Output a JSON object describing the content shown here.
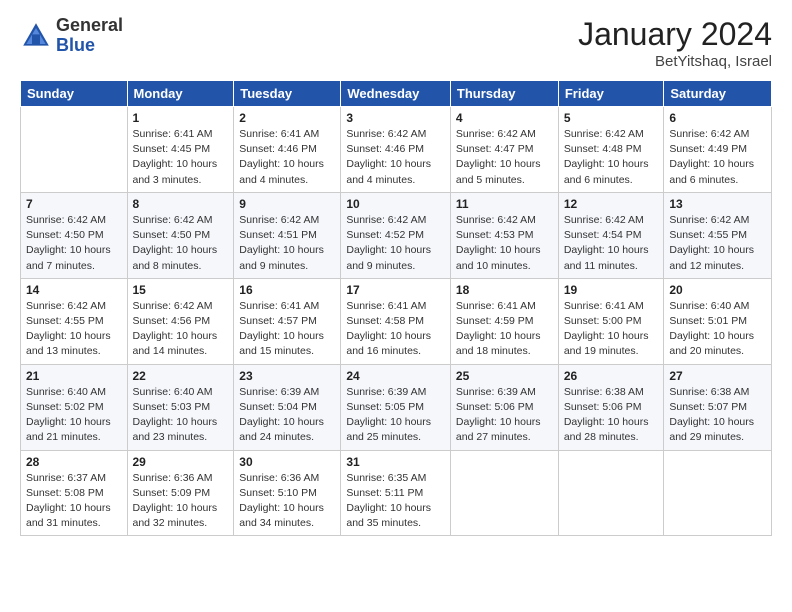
{
  "header": {
    "logo_general": "General",
    "logo_blue": "Blue",
    "title": "January 2024",
    "location": "BetYitshaq, Israel"
  },
  "days_of_week": [
    "Sunday",
    "Monday",
    "Tuesday",
    "Wednesday",
    "Thursday",
    "Friday",
    "Saturday"
  ],
  "weeks": [
    [
      {
        "day": "",
        "info": ""
      },
      {
        "day": "1",
        "info": "Sunrise: 6:41 AM\nSunset: 4:45 PM\nDaylight: 10 hours\nand 3 minutes."
      },
      {
        "day": "2",
        "info": "Sunrise: 6:41 AM\nSunset: 4:46 PM\nDaylight: 10 hours\nand 4 minutes."
      },
      {
        "day": "3",
        "info": "Sunrise: 6:42 AM\nSunset: 4:46 PM\nDaylight: 10 hours\nand 4 minutes."
      },
      {
        "day": "4",
        "info": "Sunrise: 6:42 AM\nSunset: 4:47 PM\nDaylight: 10 hours\nand 5 minutes."
      },
      {
        "day": "5",
        "info": "Sunrise: 6:42 AM\nSunset: 4:48 PM\nDaylight: 10 hours\nand 6 minutes."
      },
      {
        "day": "6",
        "info": "Sunrise: 6:42 AM\nSunset: 4:49 PM\nDaylight: 10 hours\nand 6 minutes."
      }
    ],
    [
      {
        "day": "7",
        "info": "Sunrise: 6:42 AM\nSunset: 4:50 PM\nDaylight: 10 hours\nand 7 minutes."
      },
      {
        "day": "8",
        "info": "Sunrise: 6:42 AM\nSunset: 4:50 PM\nDaylight: 10 hours\nand 8 minutes."
      },
      {
        "day": "9",
        "info": "Sunrise: 6:42 AM\nSunset: 4:51 PM\nDaylight: 10 hours\nand 9 minutes."
      },
      {
        "day": "10",
        "info": "Sunrise: 6:42 AM\nSunset: 4:52 PM\nDaylight: 10 hours\nand 9 minutes."
      },
      {
        "day": "11",
        "info": "Sunrise: 6:42 AM\nSunset: 4:53 PM\nDaylight: 10 hours\nand 10 minutes."
      },
      {
        "day": "12",
        "info": "Sunrise: 6:42 AM\nSunset: 4:54 PM\nDaylight: 10 hours\nand 11 minutes."
      },
      {
        "day": "13",
        "info": "Sunrise: 6:42 AM\nSunset: 4:55 PM\nDaylight: 10 hours\nand 12 minutes."
      }
    ],
    [
      {
        "day": "14",
        "info": "Sunrise: 6:42 AM\nSunset: 4:55 PM\nDaylight: 10 hours\nand 13 minutes."
      },
      {
        "day": "15",
        "info": "Sunrise: 6:42 AM\nSunset: 4:56 PM\nDaylight: 10 hours\nand 14 minutes."
      },
      {
        "day": "16",
        "info": "Sunrise: 6:41 AM\nSunset: 4:57 PM\nDaylight: 10 hours\nand 15 minutes."
      },
      {
        "day": "17",
        "info": "Sunrise: 6:41 AM\nSunset: 4:58 PM\nDaylight: 10 hours\nand 16 minutes."
      },
      {
        "day": "18",
        "info": "Sunrise: 6:41 AM\nSunset: 4:59 PM\nDaylight: 10 hours\nand 18 minutes."
      },
      {
        "day": "19",
        "info": "Sunrise: 6:41 AM\nSunset: 5:00 PM\nDaylight: 10 hours\nand 19 minutes."
      },
      {
        "day": "20",
        "info": "Sunrise: 6:40 AM\nSunset: 5:01 PM\nDaylight: 10 hours\nand 20 minutes."
      }
    ],
    [
      {
        "day": "21",
        "info": "Sunrise: 6:40 AM\nSunset: 5:02 PM\nDaylight: 10 hours\nand 21 minutes."
      },
      {
        "day": "22",
        "info": "Sunrise: 6:40 AM\nSunset: 5:03 PM\nDaylight: 10 hours\nand 23 minutes."
      },
      {
        "day": "23",
        "info": "Sunrise: 6:39 AM\nSunset: 5:04 PM\nDaylight: 10 hours\nand 24 minutes."
      },
      {
        "day": "24",
        "info": "Sunrise: 6:39 AM\nSunset: 5:05 PM\nDaylight: 10 hours\nand 25 minutes."
      },
      {
        "day": "25",
        "info": "Sunrise: 6:39 AM\nSunset: 5:06 PM\nDaylight: 10 hours\nand 27 minutes."
      },
      {
        "day": "26",
        "info": "Sunrise: 6:38 AM\nSunset: 5:06 PM\nDaylight: 10 hours\nand 28 minutes."
      },
      {
        "day": "27",
        "info": "Sunrise: 6:38 AM\nSunset: 5:07 PM\nDaylight: 10 hours\nand 29 minutes."
      }
    ],
    [
      {
        "day": "28",
        "info": "Sunrise: 6:37 AM\nSunset: 5:08 PM\nDaylight: 10 hours\nand 31 minutes."
      },
      {
        "day": "29",
        "info": "Sunrise: 6:36 AM\nSunset: 5:09 PM\nDaylight: 10 hours\nand 32 minutes."
      },
      {
        "day": "30",
        "info": "Sunrise: 6:36 AM\nSunset: 5:10 PM\nDaylight: 10 hours\nand 34 minutes."
      },
      {
        "day": "31",
        "info": "Sunrise: 6:35 AM\nSunset: 5:11 PM\nDaylight: 10 hours\nand 35 minutes."
      },
      {
        "day": "",
        "info": ""
      },
      {
        "day": "",
        "info": ""
      },
      {
        "day": "",
        "info": ""
      }
    ]
  ]
}
